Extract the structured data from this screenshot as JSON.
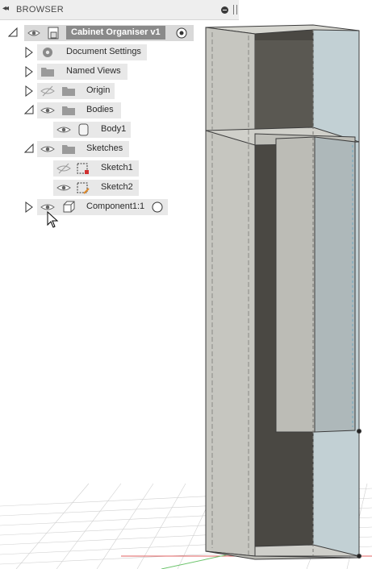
{
  "browser": {
    "header_title": "BROWSER",
    "collapse_glyph": "◂◂",
    "items": [
      {
        "label": "Cabinet Organiser v1",
        "expander": "expanded",
        "visible": true,
        "icon": "component-doc-icon",
        "active": true
      },
      {
        "label": "Document Settings",
        "expander": "collapsed",
        "icon": "gear-icon"
      },
      {
        "label": "Named Views",
        "expander": "collapsed",
        "icon": "folder-icon"
      },
      {
        "label": "Origin",
        "expander": "collapsed",
        "visible": false,
        "icon": "folder-icon"
      },
      {
        "label": "Bodies",
        "expander": "expanded",
        "visible": true,
        "icon": "folder-icon"
      },
      {
        "label": "Body1",
        "visible": true,
        "icon": "body-icon"
      },
      {
        "label": "Sketches",
        "expander": "expanded",
        "visible": true,
        "icon": "folder-icon"
      },
      {
        "label": "Sketch1",
        "visible": false,
        "icon": "sketch-icon"
      },
      {
        "label": "Sketch2",
        "visible": true,
        "icon": "sketch-icon"
      },
      {
        "label": "Component1:1",
        "expander": "collapsed",
        "visible": true,
        "icon": "component-icon",
        "active": false
      }
    ]
  },
  "colors": {
    "header_bg": "#eeeeee",
    "row_bg": "#e8e8e8",
    "root_label_bg": "#8a8a8a",
    "model_face": "#c8c8c2",
    "model_side_tint": "#b7c9cd"
  }
}
